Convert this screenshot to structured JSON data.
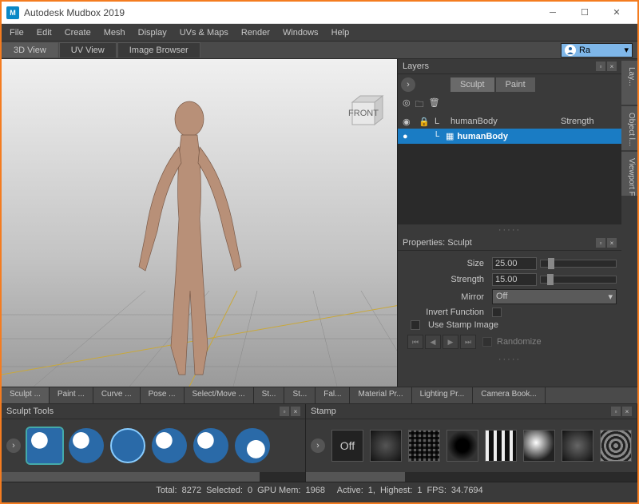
{
  "window": {
    "title": "Autodesk Mudbox 2019",
    "logo_text": "M"
  },
  "menubar": {
    "items": [
      "File",
      "Edit",
      "Create",
      "Mesh",
      "Display",
      "UVs & Maps",
      "Render",
      "Windows",
      "Help"
    ]
  },
  "view_tabs": {
    "items": [
      "3D View",
      "UV View",
      "Image Browser"
    ],
    "active": 0
  },
  "user_selector": {
    "text": "Ra"
  },
  "side_tabs": {
    "items": [
      "Lay...",
      "Object l...",
      "Viewport Fil..."
    ]
  },
  "layers": {
    "title": "Layers",
    "mode_buttons": [
      "Sculpt",
      "Paint"
    ],
    "mode_active": 0,
    "columns": {
      "c3": "L",
      "c4": "humanBody",
      "c5": "Strength"
    },
    "rows": [
      {
        "name": "humanBody",
        "selected": true
      }
    ]
  },
  "properties": {
    "title": "Properties: Sculpt",
    "size_label": "Size",
    "size_value": "25.00",
    "strength_label": "Strength",
    "strength_value": "15.00",
    "mirror_label": "Mirror",
    "mirror_value": "Off",
    "invert_label": "Invert Function",
    "stamp_label": "Use Stamp Image",
    "randomize_label": "Randomize"
  },
  "tool_tabs": {
    "items": [
      "Sculpt ...",
      "Paint ...",
      "Curve ...",
      "Pose ...",
      "Select/Move ...",
      "St...",
      "St...",
      "Fal...",
      "Material Pr...",
      "Lighting Pr...",
      "Camera Book..."
    ],
    "active": 0
  },
  "sculpt_panel": {
    "title": "Sculpt Tools"
  },
  "stamp_panel": {
    "title": "Stamp",
    "off_label": "Off"
  },
  "statusbar": {
    "total_label": "Total:",
    "total": "8272",
    "selected_label": "Selected:",
    "selected": "0",
    "gpu_label": "GPU Mem:",
    "gpu": "1968",
    "active_label": "Active:",
    "active": "1,",
    "highest_label": "Highest:",
    "highest": "1",
    "fps_label": "FPS:",
    "fps": "34.7694"
  },
  "viewcube": {
    "face": "FRONT"
  }
}
